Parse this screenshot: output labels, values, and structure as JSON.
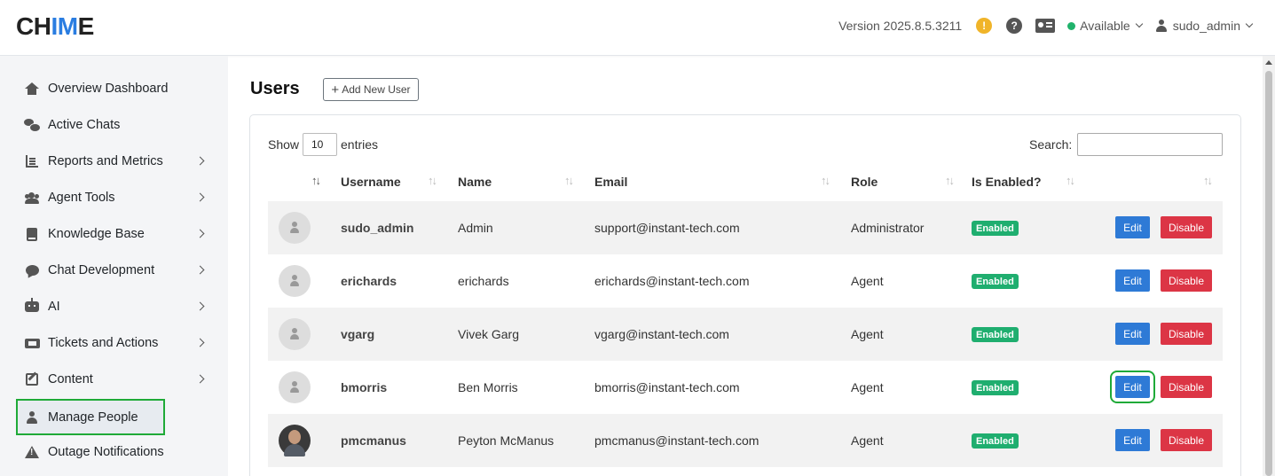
{
  "header": {
    "logo_left": "CH",
    "logo_accent": "IM",
    "logo_right": "E",
    "version": "Version 2025.8.5.3211",
    "warn_icon": "!",
    "help_icon": "?",
    "status": "Available",
    "status_color": "#20b26b",
    "username": "sudo_admin"
  },
  "sidebar": {
    "items": [
      {
        "label": "Overview Dashboard",
        "icon": "home-icon"
      },
      {
        "label": "Active Chats",
        "icon": "chats-icon"
      },
      {
        "label": "Reports and Metrics",
        "icon": "chart-icon"
      },
      {
        "label": "Agent Tools",
        "icon": "users-icon"
      },
      {
        "label": "Knowledge Base",
        "icon": "book-icon"
      },
      {
        "label": "Chat Development",
        "icon": "comment-icon"
      },
      {
        "label": "AI",
        "icon": "robot-icon"
      },
      {
        "label": "Tickets and Actions",
        "icon": "ticket-icon"
      },
      {
        "label": "Content",
        "icon": "edit-icon"
      },
      {
        "label": "Manage People",
        "icon": "person-icon"
      },
      {
        "label": "Outage Notifications",
        "icon": "warning-icon"
      }
    ]
  },
  "main": {
    "title": "Users",
    "add_button": "Add New User",
    "add_button_icon": "+",
    "show_label": "Show",
    "page_length": "10",
    "entries_label": "entries",
    "search_label": "Search:",
    "search_value": "",
    "columns": [
      "Username",
      "Name",
      "Email",
      "Role",
      "Is Enabled?"
    ],
    "sort_icon": "↑↓",
    "rows": [
      {
        "username": "sudo_admin",
        "name": "Admin",
        "email": "support@instant-tech.com",
        "role": "Administrator",
        "enabled": "Enabled",
        "edit": "Edit",
        "disable": "Disable"
      },
      {
        "username": "erichards",
        "name": "erichards",
        "email": "erichards@instant-tech.com",
        "role": "Agent",
        "enabled": "Enabled",
        "edit": "Edit",
        "disable": "Disable"
      },
      {
        "username": "vgarg",
        "name": "Vivek Garg",
        "email": "vgarg@instant-tech.com",
        "role": "Agent",
        "enabled": "Enabled",
        "edit": "Edit",
        "disable": "Disable"
      },
      {
        "username": "bmorris",
        "name": "Ben Morris",
        "email": "bmorris@instant-tech.com",
        "role": "Agent",
        "enabled": "Enabled",
        "edit": "Edit",
        "disable": "Disable"
      },
      {
        "username": "pmcmanus",
        "name": "Peyton McManus",
        "email": "pmcmanus@instant-tech.com",
        "role": "Agent",
        "enabled": "Enabled",
        "edit": "Edit",
        "disable": "Disable"
      }
    ]
  },
  "colors": {
    "accent": "#2a7de1",
    "enabled_badge": "#1fae6f",
    "edit_button": "#2e7ad6",
    "disable_button": "#dc3545",
    "highlight": "#1faa38"
  }
}
